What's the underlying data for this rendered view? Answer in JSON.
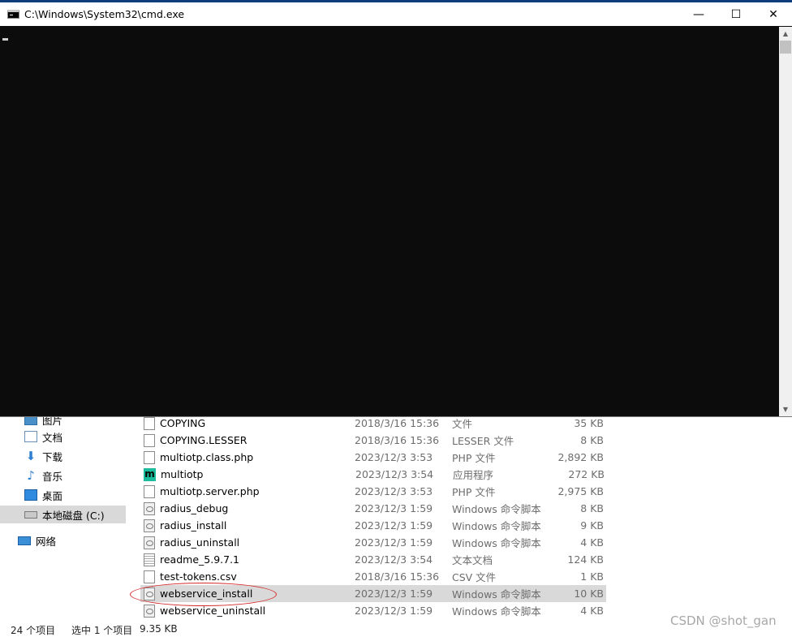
{
  "cmd_window": {
    "title": "C:\\Windows\\System32\\cmd.exe",
    "minimize_glyph": "—",
    "maximize_glyph": "☐",
    "close_glyph": "✕",
    "scroll_up_glyph": "▲",
    "scroll_down_glyph": "▼"
  },
  "nav_pane": {
    "items": [
      {
        "label": "图片",
        "icon": "pictures-icon"
      },
      {
        "label": "文档",
        "icon": "documents-icon"
      },
      {
        "label": "下载",
        "icon": "downloads-icon"
      },
      {
        "label": "音乐",
        "icon": "music-icon"
      },
      {
        "label": "桌面",
        "icon": "desktop-icon"
      },
      {
        "label": "本地磁盘 (C:)",
        "icon": "drive-icon"
      },
      {
        "label": "网络",
        "icon": "network-icon"
      }
    ]
  },
  "files": [
    {
      "name": "COPYING",
      "date": "2018/3/16 15:36",
      "type": "文件",
      "size": "35 KB",
      "icon": "doc"
    },
    {
      "name": "COPYING.LESSER",
      "date": "2018/3/16 15:36",
      "type": "LESSER 文件",
      "size": "8 KB",
      "icon": "doc"
    },
    {
      "name": "multiotp.class.php",
      "date": "2023/12/3 3:53",
      "type": "PHP 文件",
      "size": "2,892 KB",
      "icon": "doc"
    },
    {
      "name": "multiotp",
      "date": "2023/12/3 3:54",
      "type": "应用程序",
      "size": "272 KB",
      "icon": "app"
    },
    {
      "name": "multiotp.server.php",
      "date": "2023/12/3 3:53",
      "type": "PHP 文件",
      "size": "2,975 KB",
      "icon": "doc"
    },
    {
      "name": "radius_debug",
      "date": "2023/12/3 1:59",
      "type": "Windows 命令脚本",
      "size": "8 KB",
      "icon": "bat"
    },
    {
      "name": "radius_install",
      "date": "2023/12/3 1:59",
      "type": "Windows 命令脚本",
      "size": "9 KB",
      "icon": "bat"
    },
    {
      "name": "radius_uninstall",
      "date": "2023/12/3 1:59",
      "type": "Windows 命令脚本",
      "size": "4 KB",
      "icon": "bat"
    },
    {
      "name": "readme_5.9.7.1",
      "date": "2023/12/3 3:54",
      "type": "文本文档",
      "size": "124 KB",
      "icon": "txt"
    },
    {
      "name": "test-tokens.csv",
      "date": "2018/3/16 15:36",
      "type": "CSV 文件",
      "size": "1 KB",
      "icon": "doc"
    },
    {
      "name": "webservice_install",
      "date": "2023/12/3 1:59",
      "type": "Windows 命令脚本",
      "size": "10 KB",
      "icon": "bat",
      "selected": true
    },
    {
      "name": "webservice_uninstall",
      "date": "2023/12/3 1:59",
      "type": "Windows 命令脚本",
      "size": "4 KB",
      "icon": "bat"
    }
  ],
  "status_bar": {
    "item_count": "24 个项目",
    "selection": "选中 1 个项目",
    "selection_size": "9.35 KB"
  },
  "watermark": "CSDN @shot_gan",
  "colors": {
    "console_bg": "#0c0c0c",
    "selection_bg": "#d9d9d9",
    "annotation_oval": "#d52a2a",
    "app_icon": "#1abc9c"
  }
}
